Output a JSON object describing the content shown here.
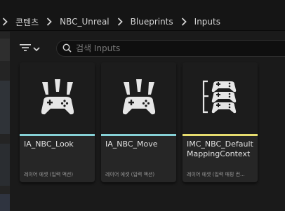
{
  "breadcrumb": {
    "items": [
      "콘텐츠",
      "NBC_Unreal",
      "Blueprints",
      "Inputs"
    ]
  },
  "search": {
    "placeholder": "검색 Inputs",
    "value": ""
  },
  "icons": {
    "filter": "filter-icon",
    "dropdown": "chevron-down-icon",
    "search": "search-icon",
    "separator": "chevron-right-icon",
    "input_action": "gamepad-icon",
    "mapping_context": "gamepad-stack-icon"
  },
  "colors": {
    "input_action_stripe": "#86d1d6",
    "mapping_context_stripe": "#e6dc6f"
  },
  "assets": [
    {
      "name": "IA_NBC_Look",
      "type": "레이어 에셋 (입력 액션)",
      "kind": "input_action"
    },
    {
      "name": "IA_NBC_Move",
      "type": "레이어 에셋 (입력 액션)",
      "kind": "input_action"
    },
    {
      "name": "IMC_NBC_Default MappingContext",
      "type": "레이어 에셋 (입력 매핑 컨...",
      "kind": "mapping_context"
    }
  ]
}
